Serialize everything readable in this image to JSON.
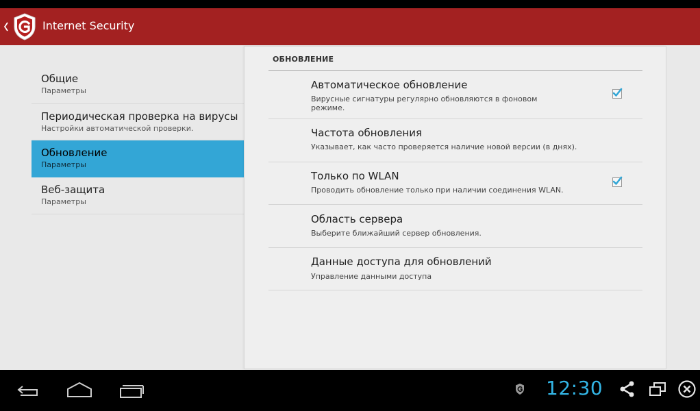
{
  "app": {
    "title": "Internet Security",
    "brand_color": "#a32121",
    "accent_color": "#33a6d6"
  },
  "left_list": {
    "items": [
      {
        "title": "Общие",
        "subtitle": "Параметры"
      },
      {
        "title": "Периодическая проверка на вирусы",
        "subtitle": "Настройки автоматической проверки."
      },
      {
        "title": "Обновление",
        "subtitle": "Параметры",
        "selected": true
      },
      {
        "title": "Веб-защита",
        "subtitle": "Параметры"
      }
    ]
  },
  "update_panel": {
    "section_header": "ОБНОВЛЕНИЕ",
    "items": [
      {
        "title": "Автоматическое обновление",
        "summary": "Вирусные сигнатуры регулярно обновляются в фоновом режиме.",
        "checked": true
      },
      {
        "title": "Частота обновления",
        "summary": "Указывает, как часто проверяется наличие новой версии (в днях)."
      },
      {
        "title": "Только по WLAN",
        "summary": "Проводить обновление только при наличии соединения WLAN.",
        "checked": true
      },
      {
        "title": "Область сервера",
        "summary": "Выберите ближайший сервер обновления."
      },
      {
        "title": "Данные доступа для обновлений",
        "summary": "Управление данными доступа"
      }
    ]
  },
  "system_bar": {
    "clock": "12:30",
    "icons": [
      "back-icon",
      "home-icon",
      "recent-apps-icon",
      "shield-notification-icon",
      "share-icon",
      "window-icon",
      "close-icon"
    ]
  }
}
